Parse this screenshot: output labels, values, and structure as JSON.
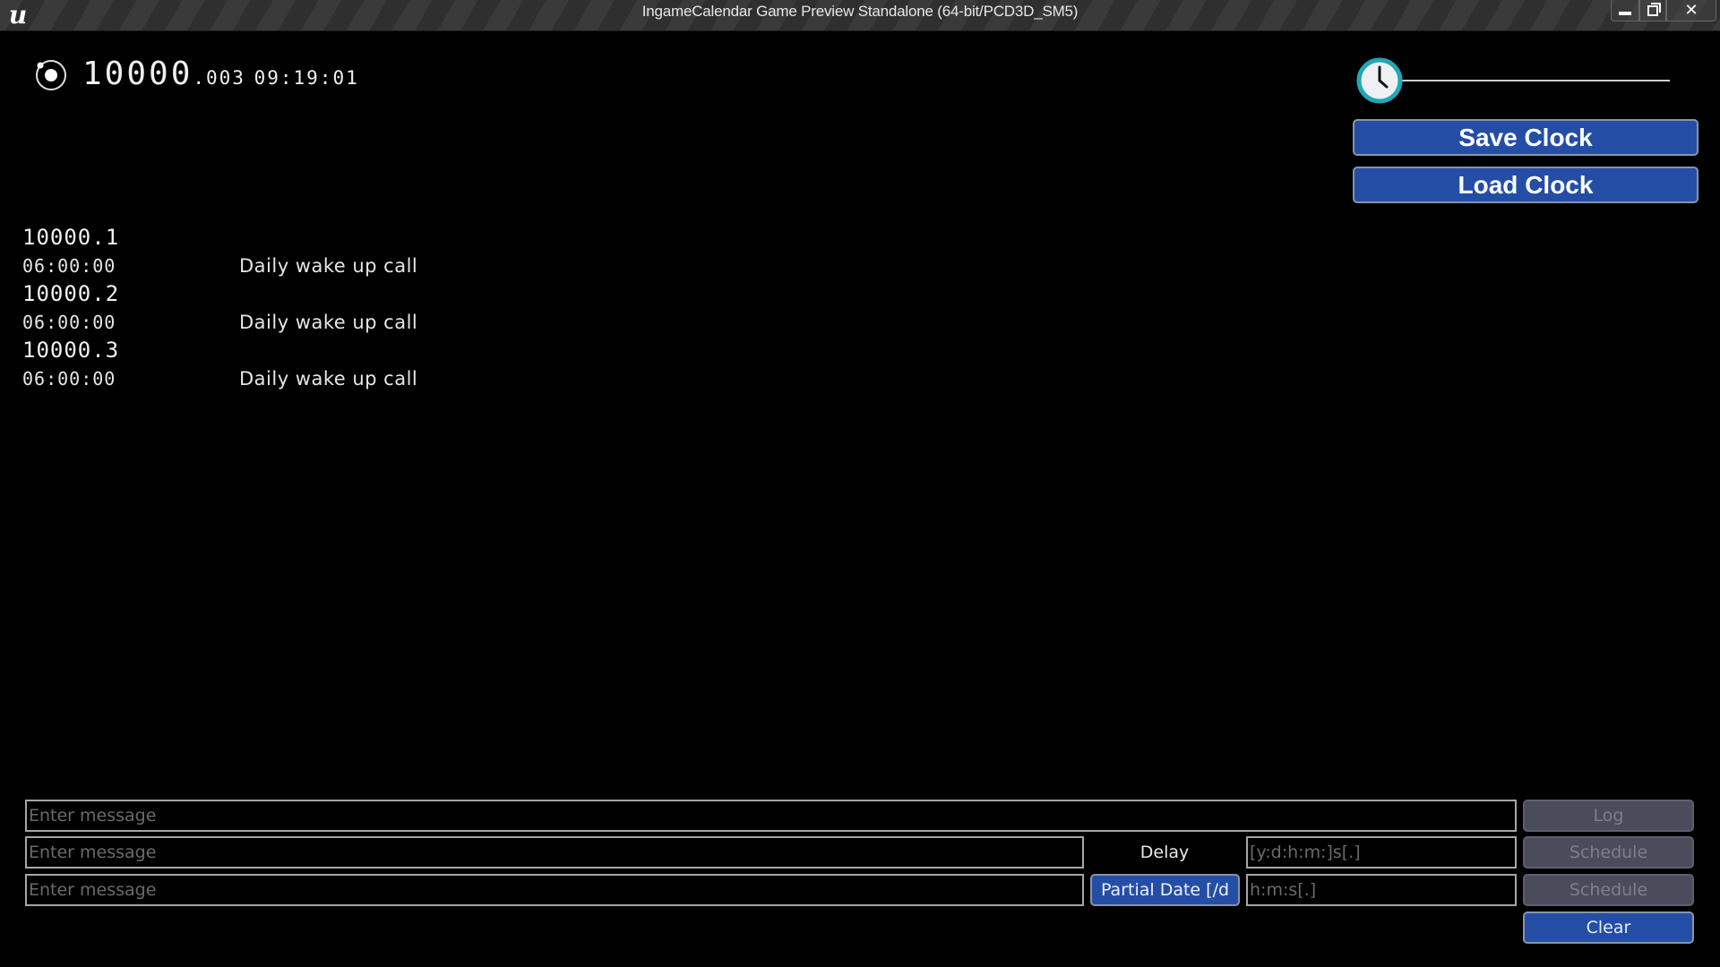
{
  "window": {
    "title": "IngameCalendar Game Preview Standalone (64-bit/PCD3D_SM5)",
    "logo_glyph": "u",
    "controls": {
      "minimize": "minimize",
      "maximize": "restore",
      "close": "✕"
    }
  },
  "clock": {
    "year": "10000",
    "day_suffix": ".003",
    "time": "09:19:01",
    "time_scale_fraction": 0.0
  },
  "clock_buttons": {
    "save_label": "Save Clock",
    "load_label": "Load Clock"
  },
  "events": [
    {
      "date": "10000.1",
      "time": "06:00:00",
      "description": "Daily wake up call"
    },
    {
      "date": "10000.2",
      "time": "06:00:00",
      "description": "Daily wake up call"
    },
    {
      "date": "10000.3",
      "time": "06:00:00",
      "description": "Daily wake up call"
    }
  ],
  "panel": {
    "log_row": {
      "message_value": "",
      "message_placeholder": "Enter message",
      "button_label": "Log"
    },
    "delay_row": {
      "message_value": "",
      "message_placeholder": "Enter message",
      "label": "Delay",
      "delay_value": "",
      "delay_placeholder": "[y:d:h:m:]s[.]",
      "button_label": "Schedule"
    },
    "partial_row": {
      "message_value": "",
      "message_placeholder": "Enter message",
      "mode_button_label": "Partial Date [/d",
      "time_value": "",
      "time_placeholder": "h:m:s[.]",
      "button_label": "Schedule"
    },
    "clear_label": "Clear"
  },
  "colors": {
    "accent_blue": "#244ea6",
    "disabled_button": "#4a4c5c",
    "slider_knob_ring": "#1fa8b8",
    "background": "#000000"
  }
}
